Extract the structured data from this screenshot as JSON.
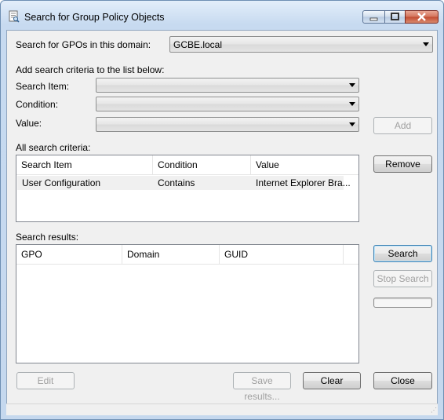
{
  "window": {
    "title": "Search for Group Policy Objects"
  },
  "domain_row": {
    "label": "Search for GPOs in this domain:",
    "value": "GCBE.local"
  },
  "criteria_section": {
    "heading": "Add search criteria to the list below:"
  },
  "search_item": {
    "label": "Search Item:",
    "value": ""
  },
  "condition": {
    "label": "Condition:",
    "value": ""
  },
  "value_field": {
    "label": "Value:",
    "value": ""
  },
  "buttons": {
    "add": "Add",
    "remove": "Remove",
    "search": "Search",
    "stop_search": "Stop Search",
    "edit": "Edit",
    "save_results": "Save results...",
    "clear": "Clear",
    "close": "Close"
  },
  "all_criteria": {
    "label": "All search criteria:",
    "columns": [
      "Search Item",
      "Condition",
      "Value"
    ],
    "rows": [
      {
        "search_item": "User Configuration",
        "condition": "Contains",
        "value": "Internet Explorer Bra..."
      }
    ]
  },
  "results": {
    "label": "Search results:",
    "columns": [
      "GPO",
      "Domain",
      "GUID"
    ],
    "rows": []
  },
  "progress": {
    "value": 0
  }
}
